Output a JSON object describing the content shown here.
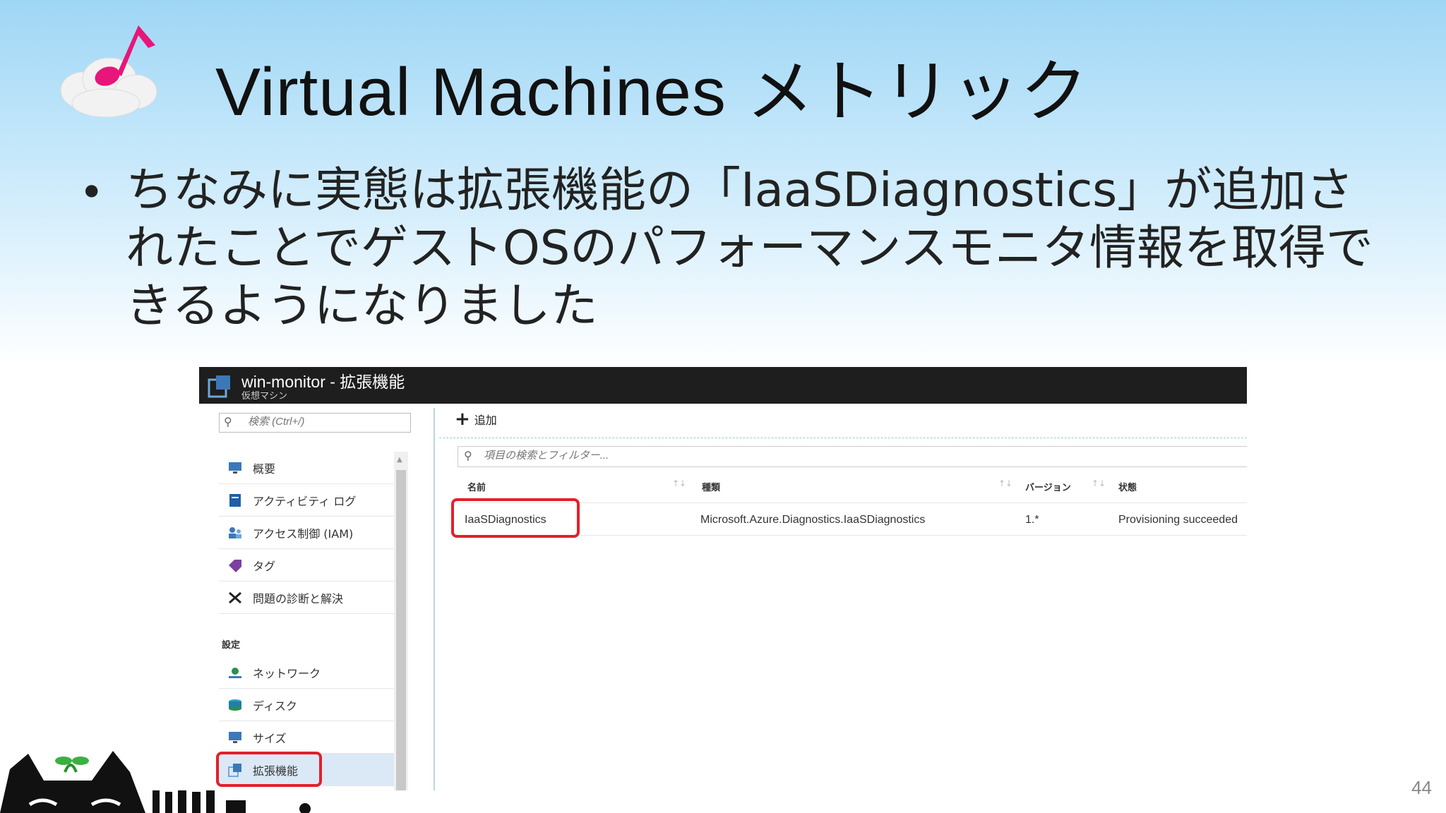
{
  "slide": {
    "title": "Virtual Machines メトリック",
    "bullet": "ちなみに実態は拡張機能の「IaaSDiagnostics」が追加されたことでゲストOSのパフォーマンスモニタ情報を取得できるようになりました",
    "page_number": "44"
  },
  "portal": {
    "title": "win-monitor - 拡張機能",
    "subtitle": "仮想マシン",
    "search_placeholder": "検索 (Ctrl+/)",
    "nav_items": [
      {
        "label": "概要",
        "icon": "monitor-icon"
      },
      {
        "label": "アクティビティ ログ",
        "icon": "activity-log-icon"
      },
      {
        "label": "アクセス制御 (IAM)",
        "icon": "iam-icon"
      },
      {
        "label": "タグ",
        "icon": "tag-icon"
      },
      {
        "label": "問題の診断と解決",
        "icon": "tools-icon"
      }
    ],
    "settings_header": "設定",
    "settings_items": [
      {
        "label": "ネットワーク",
        "icon": "network-icon"
      },
      {
        "label": "ディスク",
        "icon": "disk-icon"
      },
      {
        "label": "サイズ",
        "icon": "size-icon"
      },
      {
        "label": "拡張機能",
        "icon": "extensions-icon",
        "active": true
      }
    ],
    "add_label": "追加",
    "filter_placeholder": "項目の検索とフィルター...",
    "columns": [
      "名前",
      "種類",
      "バージョン",
      "状態"
    ],
    "rows": [
      {
        "name": "IaaSDiagnostics",
        "type": "Microsoft.Azure.Diagnostics.IaaSDiagnostics",
        "version": "1.*",
        "status": "Provisioning succeeded"
      }
    ]
  },
  "colors": {
    "highlight": "#e3202a",
    "header_bg": "#1e1e1e",
    "accent_note": "#e8157a"
  }
}
